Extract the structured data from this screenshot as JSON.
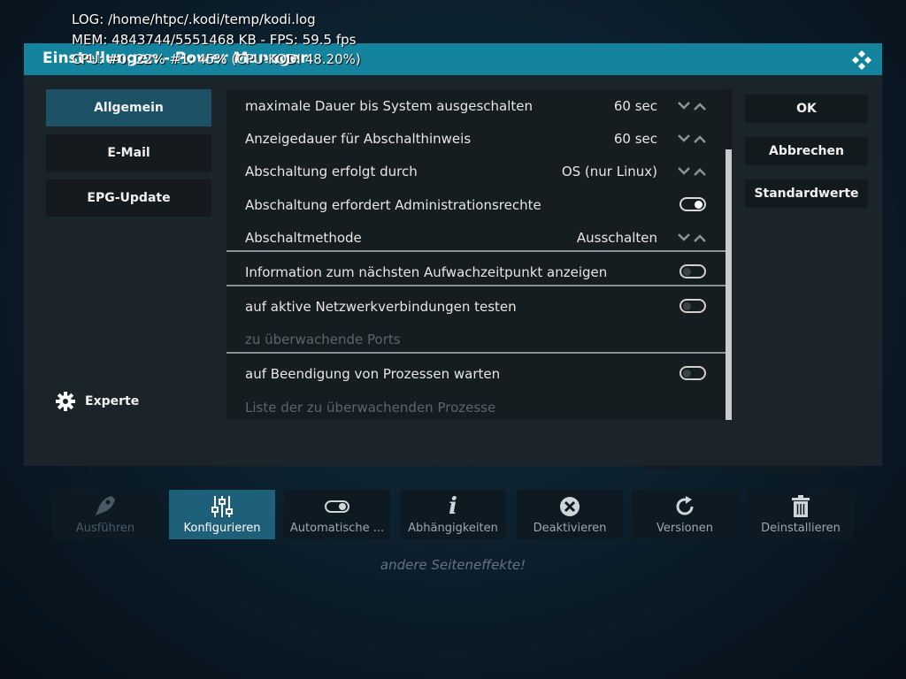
{
  "debug": {
    "log": "LOG: /home/htpc/.kodi/temp/kodi.log",
    "mem": "MEM: 4843744/5551468 KB - FPS: 59.5 fps",
    "cpu": "CPU: #0: 22% #1: 45% (CPU-KODI 48.20%)"
  },
  "dialog": {
    "title": "Einstellungen - Power Manager",
    "categories": [
      {
        "label": "Allgemein",
        "active": true
      },
      {
        "label": "E-Mail",
        "active": false
      },
      {
        "label": "EPG-Update",
        "active": false
      }
    ],
    "expert_label": "Experte",
    "settings": [
      {
        "label": "maximale Dauer bis System ausgeschalten",
        "value": "60 sec",
        "control": "spinner"
      },
      {
        "label": "Anzeigedauer für Abschalthinweis",
        "value": "60 sec",
        "control": "spinner"
      },
      {
        "label": "Abschaltung erfolgt durch",
        "value": "OS (nur Linux)",
        "control": "spinner"
      },
      {
        "label": "Abschaltung erfordert Administrationsrechte",
        "value": "",
        "control": "toggle-on"
      },
      {
        "label": "Abschaltmethode",
        "value": "Ausschalten",
        "control": "spinner"
      },
      {
        "label": "Information zum nächsten Aufwachzeitpunkt anzeigen",
        "value": "",
        "control": "toggle-off"
      },
      {
        "label": "auf aktive Netzwerkverbindungen testen",
        "value": "",
        "control": "toggle-off"
      },
      {
        "label": "zu überwachende Ports",
        "value": "",
        "control": "none"
      },
      {
        "label": "auf Beendigung von Prozessen warten",
        "value": "",
        "control": "toggle-off"
      },
      {
        "label": "Liste der zu überwachenden Prozesse",
        "value": "",
        "control": "none"
      }
    ],
    "buttons": {
      "ok": "OK",
      "cancel": "Abbrechen",
      "defaults": "Standardwerte"
    }
  },
  "addon_actions": [
    {
      "label": "Ausführen",
      "icon": "rocket-icon",
      "state": "disabled"
    },
    {
      "label": "Konfigurieren",
      "icon": "sliders-icon",
      "state": "active"
    },
    {
      "label": "Automatische ...",
      "icon": "toggle-icon",
      "state": "normal"
    },
    {
      "label": "Abhängigkeiten",
      "icon": "info-icon",
      "state": "normal"
    },
    {
      "label": "Deaktivieren",
      "icon": "close-circle-icon",
      "state": "normal"
    },
    {
      "label": "Versionen",
      "icon": "refresh-icon",
      "state": "normal"
    },
    {
      "label": "Deinstallieren",
      "icon": "trash-icon",
      "state": "normal"
    }
  ],
  "tagline": "andere Seiteneffekte!",
  "colors": {
    "accent": "#14839e",
    "active_category": "#1c5166",
    "dialog_bg": "#1b2428"
  }
}
